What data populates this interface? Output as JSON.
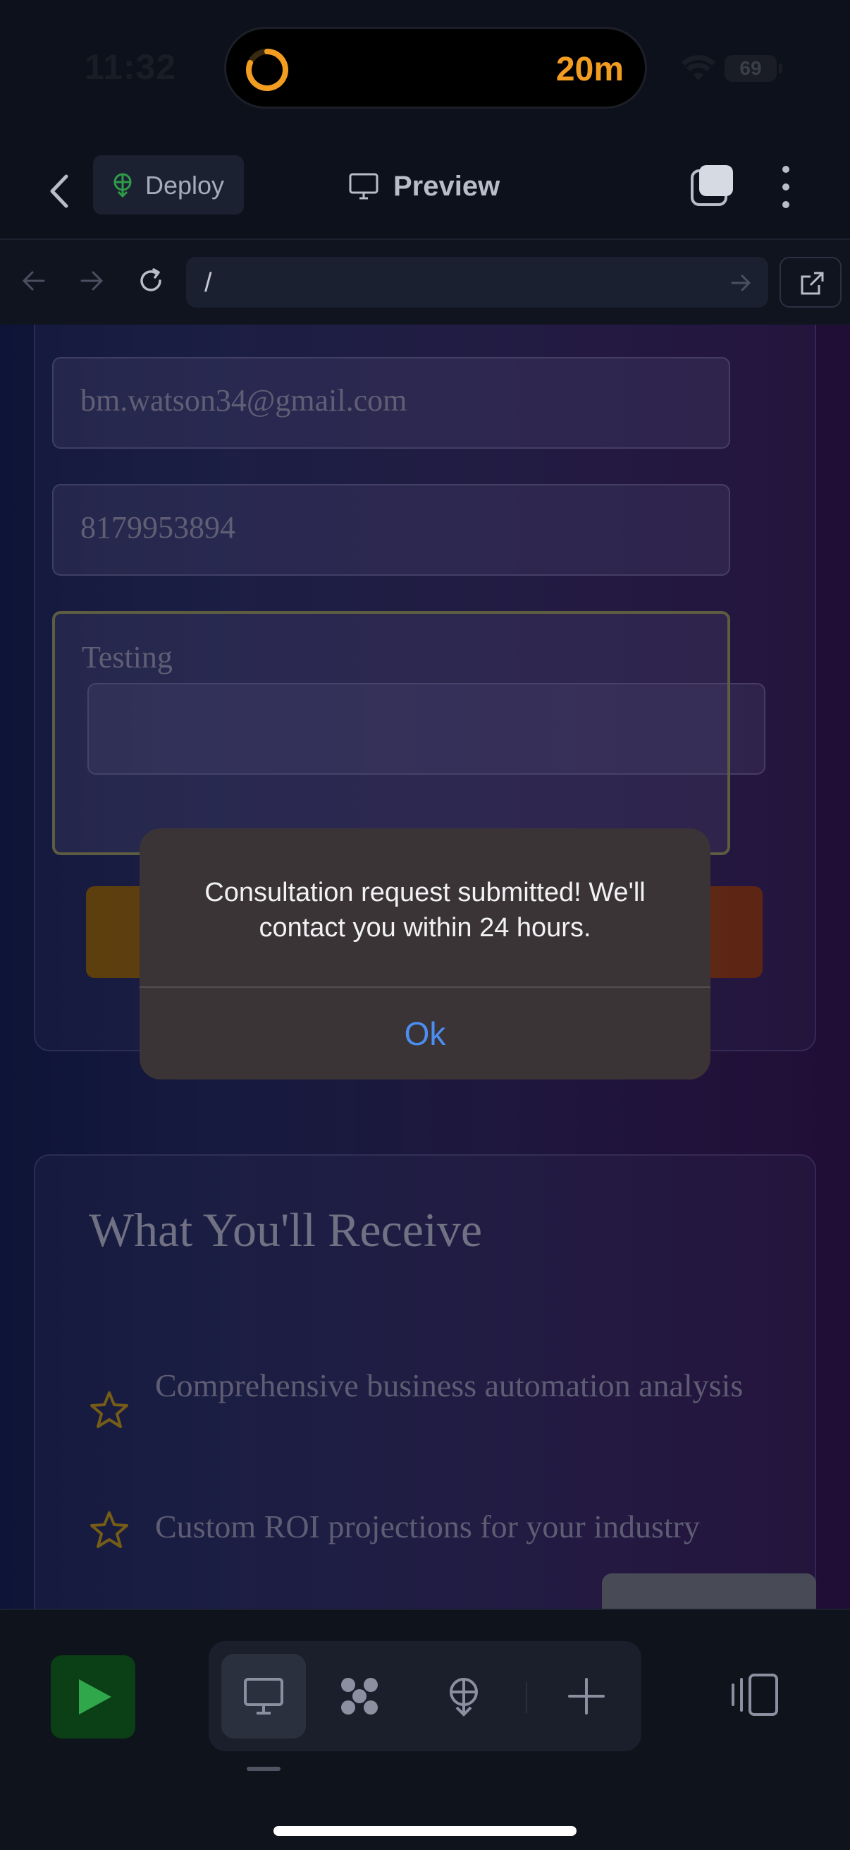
{
  "status_bar": {
    "time": "11:32",
    "timer": "20m",
    "battery": "69"
  },
  "nav": {
    "deploy_label": "Deploy",
    "preview_label": "Preview"
  },
  "url_bar": {
    "url": "/"
  },
  "form": {
    "email_value": "bm.watson34@gmail.com",
    "phone_value": "8179953894",
    "message_value": "Testing"
  },
  "receive": {
    "title": "What You'll Receive",
    "items": [
      "Comprehensive business automation analysis",
      "Custom ROI projections for your industry"
    ]
  },
  "alert": {
    "message": "Consultation request submitted! We'll contact you within 24 hours.",
    "ok_label": "Ok"
  },
  "colors": {
    "accent_blue": "#4b8ef0",
    "timer_orange": "#f29d22",
    "star_gold": "#b08a1a",
    "run_green": "#0b3f15"
  }
}
